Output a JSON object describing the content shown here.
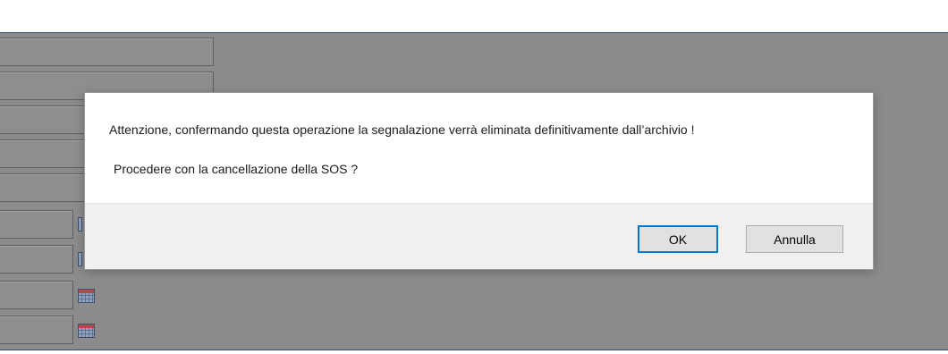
{
  "dialog": {
    "message_line1": "Attenzione, confermando questa operazione la segnalazione verrà eliminata definitivamente dall’archivio !",
    "message_line2": "Procedere con la cancellazione della SOS ?",
    "ok_label": "OK",
    "cancel_label": "Annulla"
  },
  "background": {
    "calendar_icon": "calendar-icon"
  }
}
